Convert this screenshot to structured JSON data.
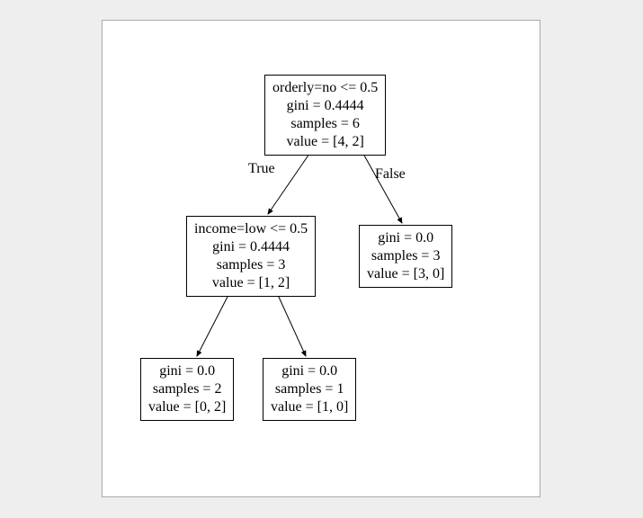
{
  "tree": {
    "root": {
      "line1": "orderly=no <= 0.5",
      "line2": "gini = 0.4444",
      "line3": "samples = 6",
      "line4": "value = [4, 2]"
    },
    "left": {
      "line1": "income=low <= 0.5",
      "line2": "gini = 0.4444",
      "line3": "samples = 3",
      "line4": "value = [1, 2]"
    },
    "right": {
      "line1": "gini = 0.0",
      "line2": "samples = 3",
      "line3": "value = [3, 0]"
    },
    "left_left": {
      "line1": "gini = 0.0",
      "line2": "samples = 2",
      "line3": "value = [0, 2]"
    },
    "left_right": {
      "line1": "gini = 0.0",
      "line2": "samples = 1",
      "line3": "value = [1, 0]"
    }
  },
  "edge_labels": {
    "true": "True",
    "false": "False"
  }
}
